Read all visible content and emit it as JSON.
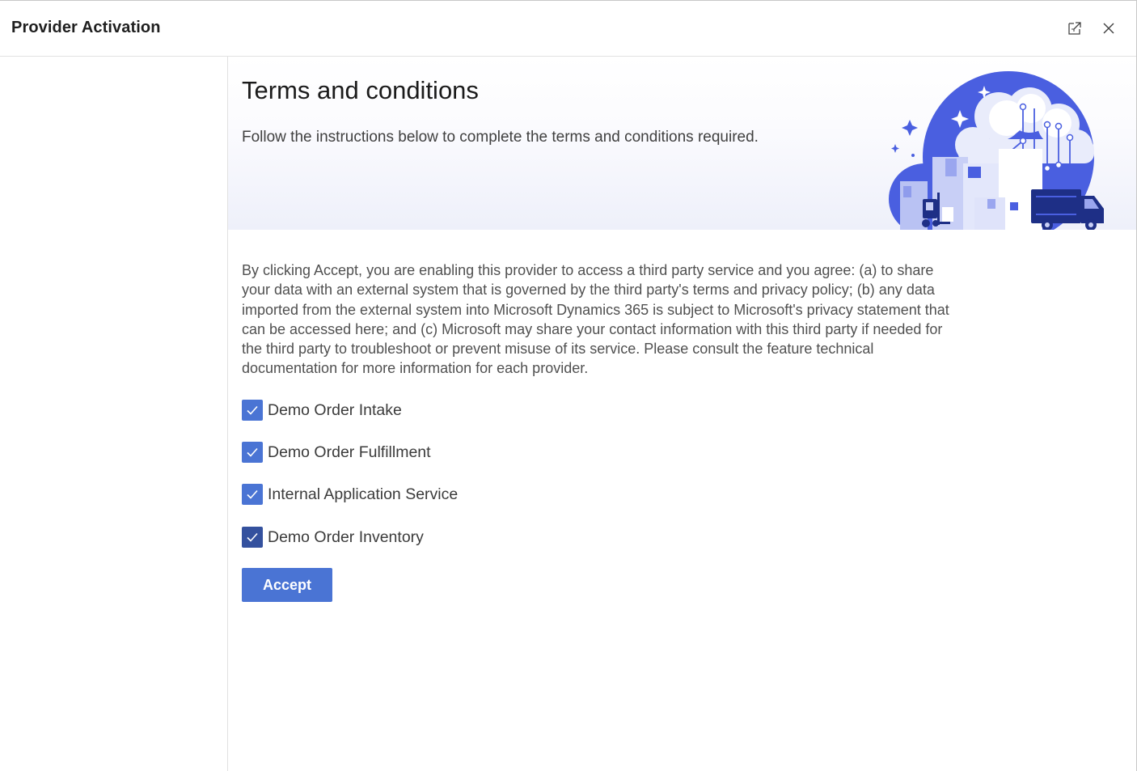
{
  "window": {
    "title": "Provider Activation",
    "popout_icon": "popout-icon",
    "close_icon": "close-icon"
  },
  "hero": {
    "title": "Terms and conditions",
    "subtitle": "Follow the instructions below to complete the terms and conditions required.",
    "illustration": "cloud-logistics-illustration"
  },
  "body": {
    "text": "By clicking Accept, you are enabling this provider to access a third party service and you agree: (a) to share your data with an external system that is governed by the third party's terms and privacy policy; (b) any data imported from the external system into Microsoft Dynamics 365 is subject to Microsoft's privacy statement that can be accessed here; and (c) Microsoft may share your contact information with this third party if needed for the third party to troubleshoot or prevent misuse of its service. Please consult the feature technical documentation for more information for each provider."
  },
  "providers": [
    {
      "label": "Demo Order Intake",
      "checked": true
    },
    {
      "label": "Demo Order Fulfillment",
      "checked": true
    },
    {
      "label": "Internal Application Service",
      "checked": true
    },
    {
      "label": "Demo Order Inventory",
      "checked": true
    }
  ],
  "actions": {
    "accept_label": "Accept"
  },
  "colors": {
    "accent": "#4a74d4",
    "accent_focused": "#34519e",
    "illustration_blue": "#4a5fe0"
  }
}
